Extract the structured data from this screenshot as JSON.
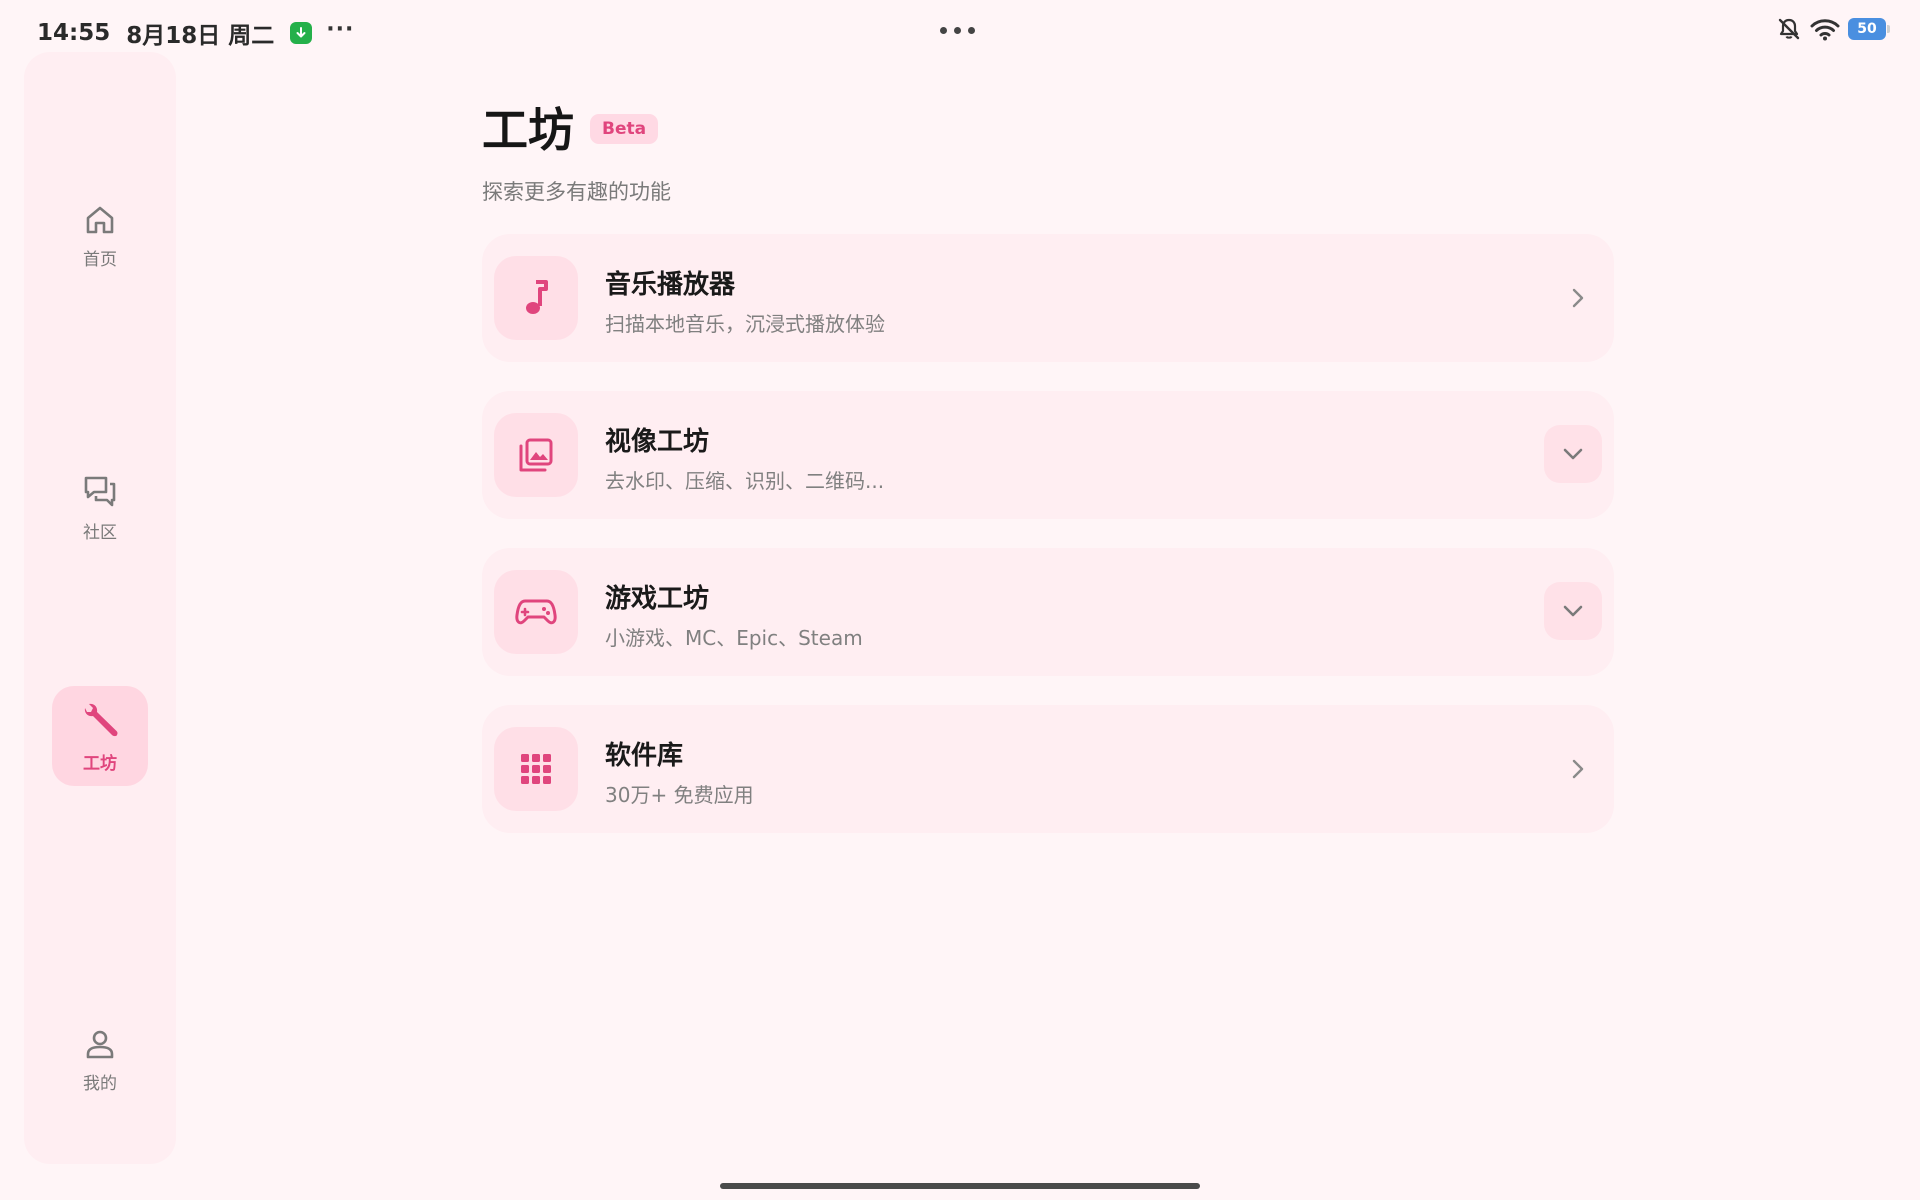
{
  "status_bar": {
    "time": "14:55",
    "date": "8月18日 周二",
    "more": "···",
    "battery": "50"
  },
  "sidebar": {
    "items": [
      {
        "label": "首页",
        "icon": "home-icon"
      },
      {
        "label": "社区",
        "icon": "chat-icon"
      },
      {
        "label": "工坊",
        "icon": "wrench-icon",
        "active": true
      },
      {
        "label": "我的",
        "icon": "person-icon"
      }
    ]
  },
  "header": {
    "title": "工坊",
    "badge": "Beta",
    "subtitle": "探索更多有趣的功能"
  },
  "cards": [
    {
      "title": "音乐播放器",
      "desc": "扫描本地音乐，沉浸式播放体验",
      "icon": "music-note-icon",
      "action": "chevron-right"
    },
    {
      "title": "视像工坊",
      "desc": "去水印、压缩、识别、二维码...",
      "icon": "image-library-icon",
      "action": "chevron-down"
    },
    {
      "title": "游戏工坊",
      "desc": "小游戏、MC、Epic、Steam",
      "icon": "gamepad-icon",
      "action": "chevron-down"
    },
    {
      "title": "软件库",
      "desc": "30万+ 免费应用",
      "icon": "app-grid-icon",
      "action": "chevron-right"
    }
  ],
  "colors": {
    "accent": "#e0457d",
    "background": "#fff5f7",
    "card": "#ffeef2"
  }
}
